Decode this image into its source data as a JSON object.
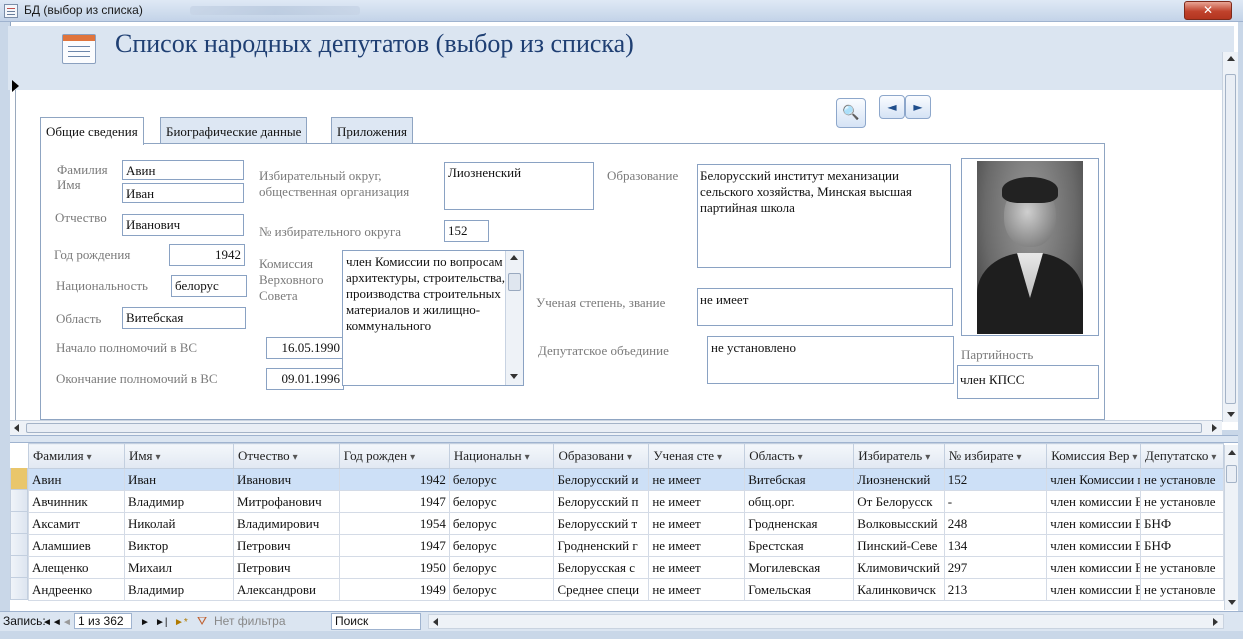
{
  "window": {
    "title": "БД (выбор из списка)",
    "close_symbol": "✕"
  },
  "form": {
    "title": "Список народных депутатов (выбор из списка)",
    "find_symbol": "🔍",
    "prev_symbol": "◄",
    "next_symbol": "►"
  },
  "tabs": [
    {
      "label": "Общие сведения"
    },
    {
      "label": "Биографические данные"
    },
    {
      "label": "Приложения"
    }
  ],
  "fields": {
    "surname": {
      "label": "Фамилия",
      "value": "Авин"
    },
    "name": {
      "label": "Имя",
      "value": "Иван"
    },
    "patronymic": {
      "label": "Отчество",
      "value": "Иванович"
    },
    "birth_year": {
      "label": "Год рождения",
      "value": "1942"
    },
    "nationality": {
      "label": "Национальность",
      "value": "белорус"
    },
    "region": {
      "label": "Область",
      "value": "Витебская"
    },
    "term_start": {
      "label": "Начало полномочий в ВС",
      "value": "16.05.1990"
    },
    "term_end": {
      "label": "Окончание полномочий в ВС",
      "value": "09.01.1996"
    },
    "district": {
      "label": "Избирательный округ, общественная организация",
      "value": "Лиозненский"
    },
    "district_no": {
      "label": "№ избирательного округа",
      "value": "152"
    },
    "commission": {
      "label": "Комиссия Верховного Совета",
      "value": "член Комиссии по вопросам архитектуры, строительства, производства строительных материалов и жилищно-коммунального"
    },
    "education": {
      "label": "Образование",
      "value": "Белорусский институт механизации сельского хозяйства, Минская высшая партийная школа"
    },
    "degree": {
      "label": "Ученая степень, звание",
      "value": "не имеет"
    },
    "faction": {
      "label": "Депутатское объединие",
      "value": "не установлено"
    },
    "party": {
      "label": "Партийность",
      "value": "член КПСС"
    }
  },
  "datasheet": {
    "columns": [
      "Фамилия",
      "Имя",
      "Отчество",
      "Год рожден",
      "Национальн",
      "Образовани",
      "Ученая сте",
      "Область",
      "Избиратель",
      "№ избирате",
      "Комиссия Вер",
      "Депутатско"
    ],
    "rows": [
      [
        "Авин",
        "Иван",
        "Иванович",
        "1942",
        "белорус",
        "Белорусский и",
        "не имеет",
        "Витебская",
        "Лиозненский",
        "152",
        "член Комиссии п",
        "не установле"
      ],
      [
        "Авчинник",
        "Владимир",
        "Митрофанович",
        "1947",
        "белорус",
        "Белорусский п",
        "не имеет",
        "общ.орг.",
        "От Белорусск",
        "-",
        "член комиссии В",
        "не установле"
      ],
      [
        "Аксамит",
        "Николай",
        "Владимирович",
        "1954",
        "белорус",
        "Белорусский т",
        "не имеет",
        "Гродненская",
        "Волковысский",
        "248",
        "член комиссии В",
        "БНФ"
      ],
      [
        "Аламшиев",
        "Виктор",
        "Петрович",
        "1947",
        "белорус",
        "Гродненский г",
        "не имеет",
        "Брестская",
        "Пинский-Севе",
        "134",
        "член комиссии В",
        "БНФ"
      ],
      [
        "Алещенко",
        "Михаил",
        "Петрович",
        "1950",
        "белорус",
        "Белорусская с",
        "не имеет",
        "Могилевская",
        "Климовичский",
        "297",
        "член комиссии В",
        "не установле"
      ],
      [
        "Андреенко",
        "Владимир",
        "Александрови",
        "1949",
        "белорус",
        "Среднее специ",
        "не имеет",
        "Гомельская",
        "Калинковичск",
        "213",
        "член комиссии В",
        "не установле"
      ]
    ]
  },
  "navbar": {
    "record_label": "Запись:",
    "first": "◄◄",
    "prev": "◄",
    "record_value": "1 из 362",
    "next": "►",
    "last": "►|",
    "new": "►*",
    "filter_status": "Нет фильтра",
    "search_placeholder": "Поиск"
  },
  "colors": {
    "accent": "#1f3f73",
    "header_bg": "#dbe5f1",
    "selected_row": "#cde0f7",
    "close": "#c0422c"
  }
}
